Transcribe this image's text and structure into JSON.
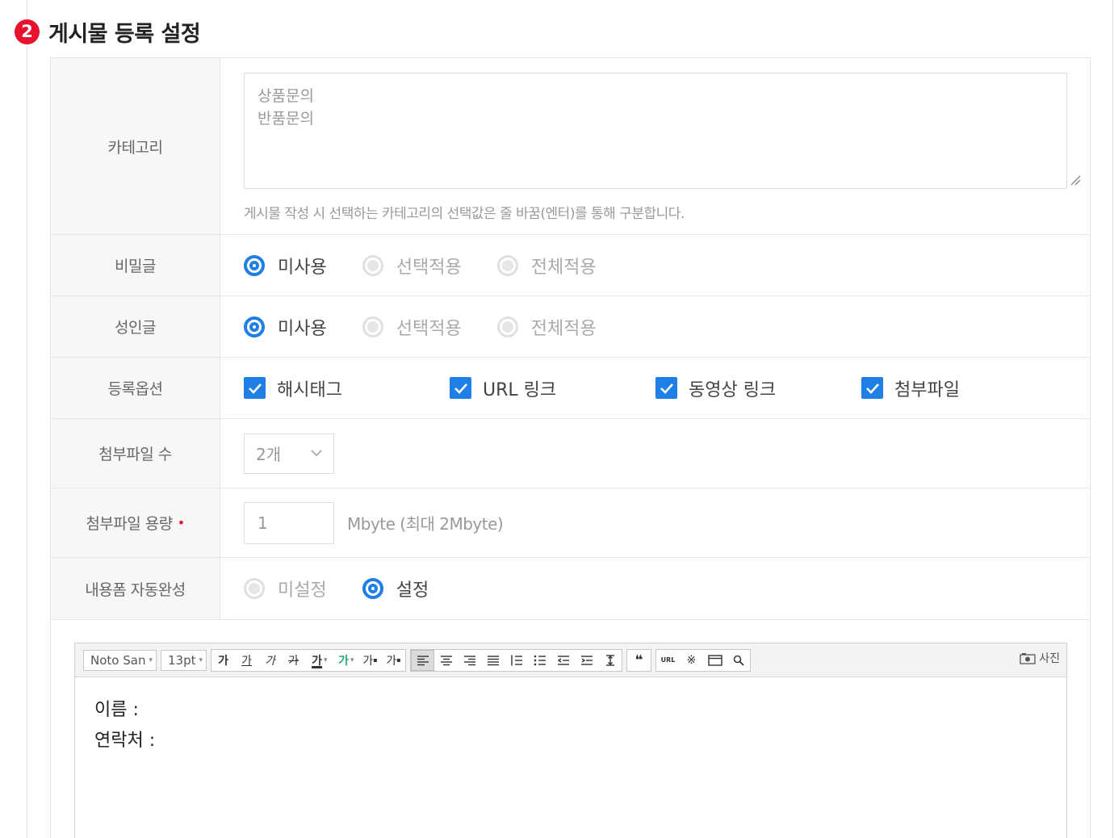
{
  "section": {
    "number": "2",
    "title": "게시물 등록 설정"
  },
  "category": {
    "label": "카테고리",
    "textarea_value": "상품문의\n반품문의",
    "help": "게시물 작성 시 선택하는 카테고리의 선택값은 줄 바꿈(엔터)를 통해 구분합니다."
  },
  "secret_post": {
    "label": "비밀글",
    "options": [
      "미사용",
      "선택적용",
      "전체적용"
    ],
    "selected": "미사용"
  },
  "adult_post": {
    "label": "성인글",
    "options": [
      "미사용",
      "선택적용",
      "전체적용"
    ],
    "selected": "미사용"
  },
  "register_options": {
    "label": "등록옵션",
    "items": [
      {
        "label": "해시태그",
        "checked": true
      },
      {
        "label": "URL 링크",
        "checked": true
      },
      {
        "label": "동영상 링크",
        "checked": true
      },
      {
        "label": "첨부파일",
        "checked": true
      }
    ]
  },
  "attach_count": {
    "label": "첨부파일 수",
    "value": "2개"
  },
  "attach_size": {
    "label": "첨부파일 용량",
    "required_mark": "•",
    "value": "1",
    "unit": "Mbyte (최대 2Mbyte)"
  },
  "autocomplete": {
    "label": "내용폼 자동완성",
    "options": [
      "미설정",
      "설정"
    ],
    "selected": "설정"
  },
  "editor": {
    "font_family": "Noto San",
    "font_size": "13pt",
    "bold": "가",
    "underline": "가",
    "italic": "가",
    "strike": "가",
    "font_color": "가",
    "bg_color": "가",
    "superscript": "가",
    "subscript": "가",
    "photo_label": "사진",
    "content": "이름 :\n연락처 :",
    "colors": {
      "accent": "#1f7fe5",
      "required": "#e8122d",
      "badge": "#e8122d"
    }
  }
}
